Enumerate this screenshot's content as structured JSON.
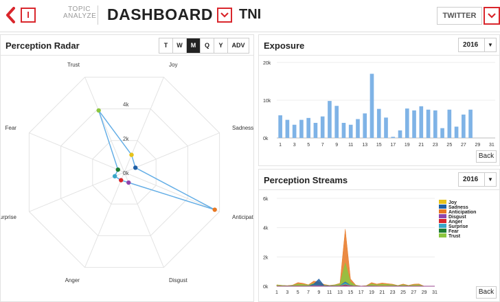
{
  "header": {
    "back_icon": "chevron-left-icon",
    "info_label": "I",
    "brand_line1": "TOPIC",
    "brand_line2": "ANALYZE",
    "title": "DASHBOARD",
    "title_dropdown_icon": "chevron-down-icon",
    "topic": "TNI",
    "source": "TWITTER",
    "source_dropdown_icon": "chevron-down-icon"
  },
  "colors": {
    "accent": "#d9262c",
    "bar": "#7fb3e6",
    "radar_line": "#64aee6"
  },
  "radar": {
    "title": "Perception Radar",
    "tabs": [
      {
        "label": "T",
        "active": false
      },
      {
        "label": "W",
        "active": false
      },
      {
        "label": "M",
        "active": true
      },
      {
        "label": "Q",
        "active": false
      },
      {
        "label": "Y",
        "active": false
      },
      {
        "label": "ADV",
        "active": false
      }
    ]
  },
  "exposure": {
    "title": "Exposure",
    "year": "2016",
    "back_label": "Back"
  },
  "streams": {
    "title": "Perception Streams",
    "year": "2016",
    "back_label": "Back"
  },
  "chart_data": [
    {
      "type": "radar",
      "axes": [
        "Joy",
        "Sadness",
        "Anticipation",
        "Disgust",
        "Anger",
        "Surprise",
        "Fear",
        "Trust"
      ],
      "values": [
        1100,
        700,
        5700,
        650,
        500,
        600,
        400,
        3900
      ],
      "point_colors": [
        "#e6c21a",
        "#1f5fa5",
        "#e87722",
        "#8e44ad",
        "#d9262c",
        "#39a7c9",
        "#1e7d32",
        "#8cc63f"
      ],
      "rings": [
        0,
        2000,
        4000,
        6000
      ],
      "ring_labels": [
        "0k",
        "2k",
        "4k"
      ],
      "grid": true
    },
    {
      "type": "bar",
      "categories": [
        "1",
        "2",
        "3",
        "4",
        "5",
        "6",
        "7",
        "8",
        "9",
        "10",
        "11",
        "12",
        "13",
        "14",
        "15",
        "16",
        "17",
        "18",
        "19",
        "20",
        "21",
        "22",
        "23",
        "24",
        "25",
        "26",
        "27",
        "28",
        "29",
        "30",
        "31"
      ],
      "x_tick_labels": [
        "1",
        "3",
        "5",
        "7",
        "9",
        "11",
        "13",
        "15",
        "17",
        "19",
        "21",
        "23",
        "25",
        "27",
        "29",
        "31"
      ],
      "values": [
        6000,
        4800,
        3500,
        4800,
        5300,
        4000,
        5700,
        9800,
        8500,
        4000,
        3500,
        5000,
        6500,
        17000,
        7700,
        5400,
        300,
        2000,
        7800,
        7300,
        8400,
        7500,
        7300,
        2600,
        7500,
        3000,
        6200,
        7500,
        0,
        0,
        0
      ],
      "ylim": [
        0,
        20000
      ],
      "y_ticks": [
        0,
        10000,
        20000
      ],
      "y_tick_labels": [
        "0k",
        "10k",
        "20k"
      ],
      "grid": true
    },
    {
      "type": "area",
      "x": [
        "1",
        "2",
        "3",
        "4",
        "5",
        "6",
        "7",
        "8",
        "9",
        "10",
        "11",
        "12",
        "13",
        "14",
        "15",
        "16",
        "17",
        "18",
        "19",
        "20",
        "21",
        "22",
        "23",
        "24",
        "25",
        "26",
        "27",
        "28",
        "29",
        "30",
        "31"
      ],
      "x_tick_labels": [
        "1",
        "3",
        "5",
        "7",
        "9",
        "11",
        "13",
        "15",
        "17",
        "19",
        "21",
        "23",
        "25",
        "27",
        "29",
        "31"
      ],
      "ylim": [
        0,
        6000
      ],
      "y_ticks": [
        0,
        2000,
        4000,
        6000
      ],
      "y_tick_labels": [
        "0k",
        "2k",
        "4k",
        "6k"
      ],
      "legend_position": "right",
      "grid": true,
      "series": [
        {
          "name": "Joy",
          "color": "#e6c21a",
          "values": [
            30,
            20,
            10,
            20,
            30,
            20,
            20,
            40,
            30,
            20,
            10,
            20,
            30,
            120,
            40,
            20,
            0,
            10,
            30,
            30,
            40,
            30,
            30,
            10,
            30,
            10,
            30,
            30,
            0,
            0,
            0
          ]
        },
        {
          "name": "Sadness",
          "color": "#1f5fa5",
          "values": [
            20,
            10,
            10,
            20,
            20,
            20,
            20,
            150,
            500,
            40,
            20,
            20,
            40,
            300,
            60,
            20,
            0,
            10,
            30,
            30,
            40,
            30,
            30,
            10,
            30,
            10,
            20,
            30,
            0,
            0,
            0
          ]
        },
        {
          "name": "Anticipation",
          "color": "#e87722",
          "values": [
            100,
            60,
            40,
            80,
            250,
            200,
            100,
            350,
            300,
            120,
            60,
            100,
            200,
            3900,
            500,
            80,
            10,
            40,
            250,
            150,
            220,
            180,
            140,
            50,
            150,
            60,
            140,
            160,
            0,
            0,
            0
          ]
        },
        {
          "name": "Disgust",
          "color": "#8e44ad",
          "values": [
            10,
            10,
            10,
            10,
            10,
            10,
            10,
            30,
            40,
            10,
            10,
            10,
            10,
            60,
            20,
            10,
            0,
            0,
            10,
            10,
            10,
            10,
            10,
            0,
            10,
            0,
            10,
            10,
            0,
            0,
            0
          ]
        },
        {
          "name": "Anger",
          "color": "#d9262c",
          "values": [
            10,
            10,
            10,
            10,
            20,
            10,
            10,
            30,
            40,
            10,
            10,
            10,
            20,
            80,
            20,
            10,
            0,
            0,
            20,
            10,
            10,
            10,
            10,
            0,
            10,
            0,
            10,
            10,
            0,
            0,
            0
          ]
        },
        {
          "name": "Surprise",
          "color": "#39a7c9",
          "values": [
            20,
            10,
            10,
            20,
            20,
            10,
            20,
            50,
            60,
            20,
            10,
            20,
            30,
            250,
            40,
            10,
            0,
            10,
            30,
            20,
            30,
            20,
            20,
            10,
            20,
            10,
            20,
            20,
            0,
            0,
            0
          ]
        },
        {
          "name": "Fear",
          "color": "#1e7d32",
          "values": [
            10,
            10,
            10,
            10,
            10,
            10,
            10,
            20,
            30,
            10,
            10,
            10,
            10,
            100,
            20,
            10,
            0,
            0,
            10,
            10,
            10,
            10,
            10,
            0,
            10,
            0,
            10,
            10,
            0,
            0,
            0
          ]
        },
        {
          "name": "Trust",
          "color": "#8cc63f",
          "values": [
            80,
            60,
            30,
            60,
            150,
            120,
            80,
            200,
            150,
            80,
            40,
            80,
            160,
            1600,
            300,
            60,
            10,
            30,
            160,
            100,
            140,
            120,
            100,
            40,
            100,
            40,
            90,
            100,
            0,
            0,
            0
          ]
        }
      ]
    }
  ]
}
